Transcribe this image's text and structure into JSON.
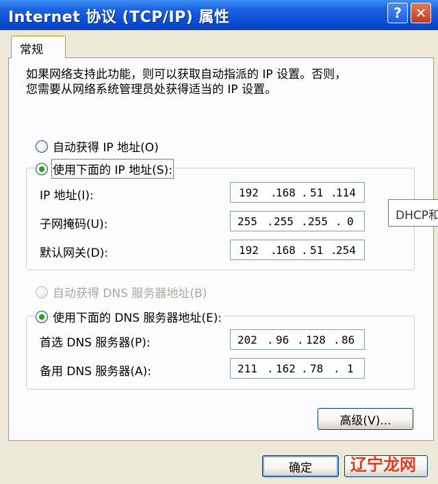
{
  "window": {
    "title": "Internet 协议 (TCP/IP) 属性",
    "help_label": "?",
    "close_label": "✕"
  },
  "tab": {
    "label": "常规"
  },
  "description": "如果网络支持此功能，则可以获取自动指派的 IP 设置。否则，\n您需要从网络系统管理员处获得适当的 IP 设置。",
  "ip": {
    "auto_label": "自动获得 IP 地址(O)",
    "manual_label": "使用下面的 IP 地址(S):",
    "address_label": "IP 地址(I):",
    "address": [
      "192",
      "168",
      "51",
      "114"
    ],
    "mask_label": "子网掩码(U):",
    "mask": [
      "255",
      "255",
      "255",
      "0"
    ],
    "gateway_label": "默认网关(D):",
    "gateway": [
      "192",
      "168",
      "51",
      "254"
    ]
  },
  "tooltip": "DHCP和",
  "dns": {
    "auto_label": "自动获得 DNS 服务器地址(B)",
    "manual_label": "使用下面的 DNS 服务器地址(E):",
    "preferred_label": "首选 DNS 服务器(P):",
    "preferred": [
      "202",
      "96",
      "128",
      "86"
    ],
    "alternate_label": "备用 DNS 服务器(A):",
    "alternate": [
      "211",
      "162",
      "78",
      "1"
    ]
  },
  "buttons": {
    "advanced": "高级(V)...",
    "ok": "确定",
    "cancel": ""
  },
  "watermark": "辽宁龙网",
  "colors": {
    "titlebar": "#0a4ed6",
    "checked_radio": "#21a121",
    "tab_highlight": "#ffc83c"
  }
}
